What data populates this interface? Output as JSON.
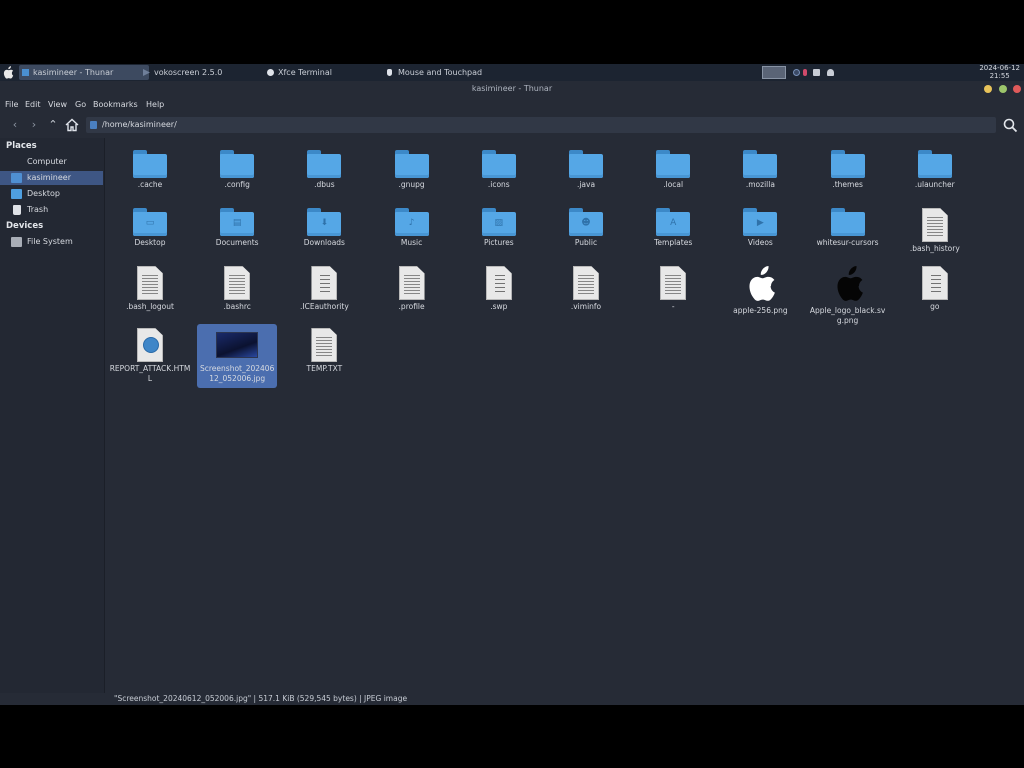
{
  "taskbar": {
    "tasks": [
      {
        "label": "kasimineer - Thunar",
        "icon": "folder-icon",
        "active": true
      },
      {
        "label": "vokoscreen 2.5.0",
        "icon": "vokoscreen-icon",
        "active": false
      },
      {
        "label": "Xfce Terminal",
        "icon": "terminal-icon",
        "active": false
      },
      {
        "label": "Mouse and Touchpad",
        "icon": "mouse-icon",
        "active": false
      }
    ],
    "clock_date": "2024-06-12",
    "clock_time": "21:55"
  },
  "window": {
    "title": "kasimineer - Thunar"
  },
  "menubar": [
    "File",
    "Edit",
    "View",
    "Go",
    "Bookmarks",
    "Help"
  ],
  "toolbar": {
    "path": "/home/kasimineer/"
  },
  "sidebar": {
    "places_header": "Places",
    "places": [
      {
        "label": "Computer",
        "icon": "computer-icon",
        "selected": false
      },
      {
        "label": "kasimineer",
        "icon": "home-folder-icon",
        "selected": true
      },
      {
        "label": "Desktop",
        "icon": "desktop-folder-icon",
        "selected": false
      },
      {
        "label": "Trash",
        "icon": "trash-icon",
        "selected": false
      }
    ],
    "devices_header": "Devices",
    "devices": [
      {
        "label": "File System",
        "icon": "drive-icon",
        "selected": false
      }
    ]
  },
  "files": [
    {
      "label": ".cache",
      "kind": "folder",
      "emblem": ""
    },
    {
      "label": ".config",
      "kind": "folder",
      "emblem": ""
    },
    {
      "label": ".dbus",
      "kind": "folder",
      "emblem": ""
    },
    {
      "label": ".gnupg",
      "kind": "folder",
      "emblem": ""
    },
    {
      "label": ".icons",
      "kind": "folder",
      "emblem": ""
    },
    {
      "label": ".java",
      "kind": "folder",
      "emblem": ""
    },
    {
      "label": ".local",
      "kind": "folder",
      "emblem": ""
    },
    {
      "label": ".mozilla",
      "kind": "folder",
      "emblem": ""
    },
    {
      "label": ".themes",
      "kind": "folder",
      "emblem": ""
    },
    {
      "label": ".ulauncher",
      "kind": "folder",
      "emblem": ""
    },
    {
      "label": "Desktop",
      "kind": "folder",
      "emblem": "▭"
    },
    {
      "label": "Documents",
      "kind": "folder",
      "emblem": "▤"
    },
    {
      "label": "Downloads",
      "kind": "folder",
      "emblem": "⬇"
    },
    {
      "label": "Music",
      "kind": "folder",
      "emblem": "♪"
    },
    {
      "label": "Pictures",
      "kind": "folder",
      "emblem": "▨"
    },
    {
      "label": "Public",
      "kind": "folder",
      "emblem": "☻"
    },
    {
      "label": "Templates",
      "kind": "folder",
      "emblem": "A"
    },
    {
      "label": "Videos",
      "kind": "folder",
      "emblem": "▶"
    },
    {
      "label": "whitesur-cursors",
      "kind": "folder",
      "emblem": ""
    },
    {
      "label": ".bash_history",
      "kind": "text",
      "emblem": ""
    },
    {
      "label": ".bash_logout",
      "kind": "text",
      "emblem": ""
    },
    {
      "label": ".bashrc",
      "kind": "text",
      "emblem": ""
    },
    {
      "label": ".ICEauthority",
      "kind": "binary",
      "emblem": ""
    },
    {
      "label": ".profile",
      "kind": "text",
      "emblem": ""
    },
    {
      "label": ".swp",
      "kind": "binary",
      "emblem": ""
    },
    {
      "label": ".viminfo",
      "kind": "text",
      "emblem": ""
    },
    {
      "label": "-",
      "kind": "text",
      "emblem": ""
    },
    {
      "label": "apple-256.png",
      "kind": "apple-white",
      "emblem": ""
    },
    {
      "label": "Apple_logo_black.svg.png",
      "kind": "apple-black",
      "emblem": ""
    },
    {
      "label": "go",
      "kind": "binary",
      "emblem": ""
    },
    {
      "label": "REPORT_ATTACK.HTML",
      "kind": "html",
      "emblem": ""
    },
    {
      "label": "Screenshot_20240612_052006.jpg",
      "kind": "image",
      "emblem": "",
      "selected": true
    },
    {
      "label": "TEMP.TXT",
      "kind": "text",
      "emblem": ""
    }
  ],
  "statusbar": {
    "text": "\"Screenshot_20240612_052006.jpg\"  |  517.1 KiB (529,545 bytes)  |  JPEG image"
  },
  "colors": {
    "folder": "#55a7e6",
    "selection": "#4b6eaf",
    "window_bg": "#262b36",
    "close": "#e05a5a",
    "maximize": "#9cc56b",
    "minimize": "#e8c35a"
  }
}
